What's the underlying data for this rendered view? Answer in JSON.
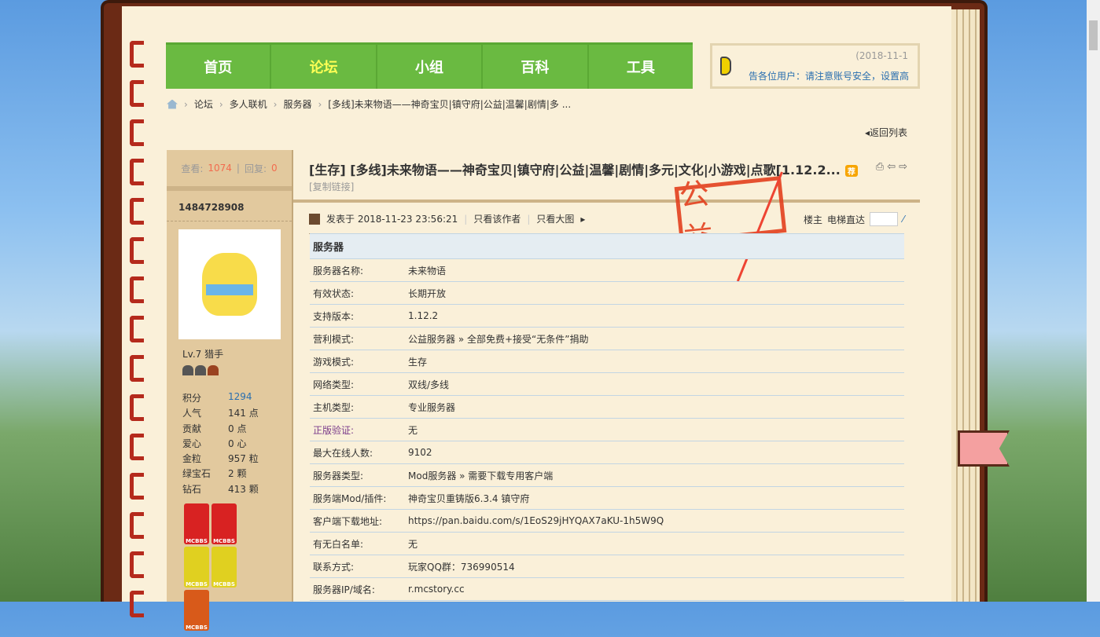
{
  "nav": [
    "首页",
    "论坛",
    "小组",
    "百科",
    "工具"
  ],
  "notice": {
    "date": "(2018-11-1",
    "text": "告各位用户：请注意账号安全，设置高"
  },
  "breadcrumb": [
    "论坛",
    "多人联机",
    "服务器",
    "[多线]未来物语——神奇宝贝|镇守府|公益|温馨|剧情|多 ..."
  ],
  "back": "返回列表",
  "stats": {
    "views_label": "查看:",
    "views": "1074",
    "replies_label": "回复:",
    "replies": "0"
  },
  "user": {
    "name": "1484728908",
    "level": "Lv.7 猎手",
    "fields": [
      [
        "积分",
        "1294"
      ],
      [
        "人气",
        "141 点"
      ],
      [
        "贡献",
        "0 点"
      ],
      [
        "爱心",
        "0 心"
      ],
      [
        "金粒",
        "957 粒"
      ],
      [
        "绿宝石",
        "2 颗"
      ],
      [
        "钻石",
        "413 颗"
      ]
    ],
    "medal_text": "MCBBS"
  },
  "post": {
    "title": "[生存] [多线]未来物语——神奇宝贝|镇守府|公益|温馨|剧情|多元|文化|小游戏|点歌[1.12.2...",
    "tag": "荐",
    "copy": "[复制链接]",
    "posted": "发表于 2018-11-23 23:56:21",
    "only_author": "只看该作者",
    "big_img": "只看大图",
    "floor": "楼主",
    "jump": "电梯直达",
    "stamp": "公益"
  },
  "table": {
    "header": "服务器",
    "rows": [
      [
        "服务器名称:",
        "未来物语"
      ],
      [
        "有效状态:",
        "长期开放"
      ],
      [
        "支持版本:",
        "1.12.2"
      ],
      [
        "营利模式:",
        "公益服务器 » 全部免费+接受“无条件”捐助"
      ],
      [
        "游戏模式:",
        "生存"
      ],
      [
        "网络类型:",
        "双线/多线"
      ],
      [
        "主机类型:",
        "专业服务器"
      ],
      [
        "正版验证:",
        "无"
      ],
      [
        "最大在线人数:",
        "9102"
      ],
      [
        "服务器类型:",
        "Mod服务器 » 需要下载专用客户端"
      ],
      [
        "服务端Mod/插件:",
        "神奇宝贝重铸版6.3.4 镇守府"
      ],
      [
        "客户端下载地址:",
        "https://pan.baidu.com/s/1EoS29jHYQAX7aKU-1h5W9Q"
      ],
      [
        "有无白名单:",
        "无"
      ],
      [
        "联系方式:",
        "玩家QQ群：736990514"
      ],
      [
        "服务器IP/域名:",
        "r.mcstory.cc"
      ]
    ]
  }
}
